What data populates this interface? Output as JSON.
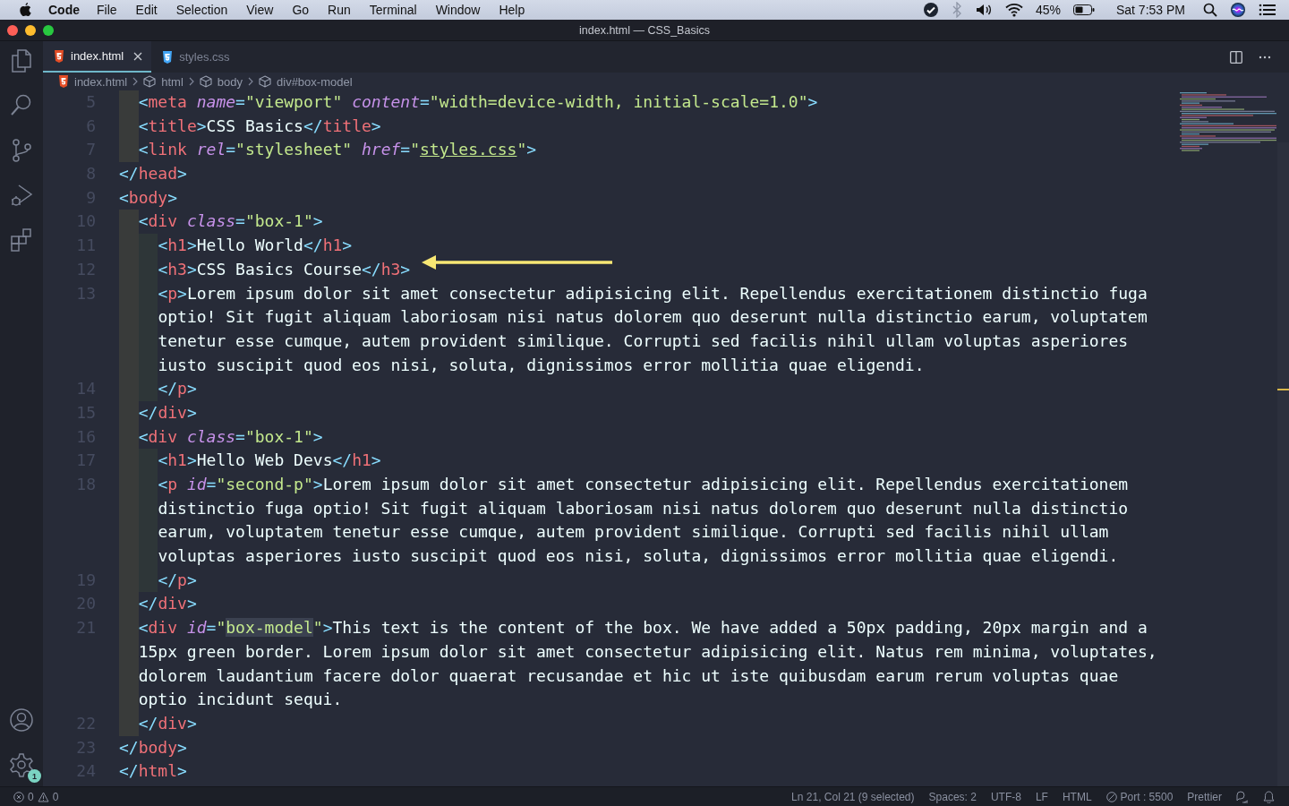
{
  "menubar": {
    "app": "Code",
    "items": [
      "File",
      "Edit",
      "Selection",
      "View",
      "Go",
      "Run",
      "Terminal",
      "Window",
      "Help"
    ],
    "battery": "45%",
    "clock": "Sat 7:53 PM"
  },
  "window": {
    "title": "index.html — CSS_Basics"
  },
  "tabs": [
    {
      "label": "index.html",
      "kind": "html",
      "selected": true
    },
    {
      "label": "styles.css",
      "kind": "css",
      "selected": false
    }
  ],
  "breadcrumbs": [
    {
      "label": "index.html",
      "kind": "file"
    },
    {
      "label": "html",
      "kind": "element"
    },
    {
      "label": "body",
      "kind": "element"
    },
    {
      "label": "div#box-model",
      "kind": "element"
    }
  ],
  "activity_bar": {
    "settings_badge": "1"
  },
  "code": [
    {
      "number": "5",
      "tokens": [
        {
          "kind": "p",
          "t": "  <"
        },
        {
          "kind": "tag",
          "t": "meta"
        },
        {
          "kind": "attr",
          "t": " name"
        },
        {
          "kind": "p",
          "t": "="
        },
        {
          "kind": "str",
          "t": "\"viewport\""
        },
        {
          "kind": "attr",
          "t": " content"
        },
        {
          "kind": "p",
          "t": "="
        },
        {
          "kind": "str",
          "t": "\"width=device-width, initial-scale=1.0\""
        },
        {
          "kind": "p",
          "t": ">"
        }
      ]
    },
    {
      "number": "6",
      "tokens": [
        {
          "kind": "p",
          "t": "  <"
        },
        {
          "kind": "tag",
          "t": "title"
        },
        {
          "kind": "p",
          "t": ">"
        },
        {
          "kind": "text",
          "t": "CSS Basics"
        },
        {
          "kind": "p",
          "t": "</"
        },
        {
          "kind": "tag",
          "t": "title"
        },
        {
          "kind": "p",
          "t": ">"
        }
      ]
    },
    {
      "number": "7",
      "tokens": [
        {
          "kind": "p",
          "t": "  <"
        },
        {
          "kind": "tag",
          "t": "link"
        },
        {
          "kind": "attr",
          "t": " rel"
        },
        {
          "kind": "p",
          "t": "="
        },
        {
          "kind": "str",
          "t": "\"stylesheet\""
        },
        {
          "kind": "attr",
          "t": " href"
        },
        {
          "kind": "p",
          "t": "="
        },
        {
          "kind": "str",
          "t": "\""
        },
        {
          "kind": "link",
          "t": "styles.css"
        },
        {
          "kind": "str",
          "t": "\""
        },
        {
          "kind": "p",
          "t": ">"
        }
      ]
    },
    {
      "number": "8",
      "tokens": [
        {
          "kind": "p",
          "t": "</"
        },
        {
          "kind": "tag",
          "t": "head"
        },
        {
          "kind": "p",
          "t": ">"
        }
      ]
    },
    {
      "number": "9",
      "tokens": [
        {
          "kind": "p",
          "t": "<"
        },
        {
          "kind": "tag",
          "t": "body"
        },
        {
          "kind": "p",
          "t": ">"
        }
      ]
    },
    {
      "number": "10",
      "tokens": [
        {
          "kind": "p",
          "t": "  <"
        },
        {
          "kind": "tag",
          "t": "div"
        },
        {
          "kind": "attr",
          "t": " class"
        },
        {
          "kind": "p",
          "t": "="
        },
        {
          "kind": "str",
          "t": "\"box-1\""
        },
        {
          "kind": "p",
          "t": ">"
        }
      ]
    },
    {
      "number": "11",
      "tokens": [
        {
          "kind": "p",
          "t": "    <"
        },
        {
          "kind": "tag",
          "t": "h1"
        },
        {
          "kind": "p",
          "t": ">"
        },
        {
          "kind": "text",
          "t": "Hello World"
        },
        {
          "kind": "p",
          "t": "</"
        },
        {
          "kind": "tag",
          "t": "h1"
        },
        {
          "kind": "p",
          "t": ">"
        }
      ]
    },
    {
      "number": "12",
      "tokens": [
        {
          "kind": "p",
          "t": "    <"
        },
        {
          "kind": "tag",
          "t": "h3"
        },
        {
          "kind": "p",
          "t": ">"
        },
        {
          "kind": "text",
          "t": "CSS Basics Course"
        },
        {
          "kind": "p",
          "t": "</"
        },
        {
          "kind": "tag",
          "t": "h3"
        },
        {
          "kind": "p",
          "t": ">"
        }
      ]
    },
    {
      "number": "13",
      "tokens": [
        {
          "kind": "p",
          "t": "    <"
        },
        {
          "kind": "tag",
          "t": "p"
        },
        {
          "kind": "p",
          "t": ">"
        },
        {
          "kind": "text",
          "t": "Lorem ipsum dolor sit amet consectetur adipisicing elit. Repellendus exercitationem distinctio fuga"
        }
      ]
    },
    {
      "tokens": [
        {
          "kind": "text",
          "t": "    optio! Sit fugit aliquam laboriosam nisi natus dolorem quo deserunt nulla distinctio earum, voluptatem"
        }
      ]
    },
    {
      "tokens": [
        {
          "kind": "text",
          "t": "    tenetur esse cumque, autem provident similique. Corrupti sed facilis nihil ullam voluptas asperiores"
        }
      ]
    },
    {
      "tokens": [
        {
          "kind": "text",
          "t": "    iusto suscipit quod eos nisi, soluta, dignissimos error mollitia quae eligendi."
        }
      ]
    },
    {
      "number": "14",
      "tokens": [
        {
          "kind": "p",
          "t": "    </"
        },
        {
          "kind": "tag",
          "t": "p"
        },
        {
          "kind": "p",
          "t": ">"
        }
      ]
    },
    {
      "number": "15",
      "tokens": [
        {
          "kind": "p",
          "t": "  </"
        },
        {
          "kind": "tag",
          "t": "div"
        },
        {
          "kind": "p",
          "t": ">"
        }
      ]
    },
    {
      "number": "16",
      "tokens": [
        {
          "kind": "p",
          "t": "  <"
        },
        {
          "kind": "tag",
          "t": "div"
        },
        {
          "kind": "attr",
          "t": " class"
        },
        {
          "kind": "p",
          "t": "="
        },
        {
          "kind": "str",
          "t": "\"box-1\""
        },
        {
          "kind": "p",
          "t": ">"
        }
      ]
    },
    {
      "number": "17",
      "tokens": [
        {
          "kind": "p",
          "t": "    <"
        },
        {
          "kind": "tag",
          "t": "h1"
        },
        {
          "kind": "p",
          "t": ">"
        },
        {
          "kind": "text",
          "t": "Hello Web Devs"
        },
        {
          "kind": "p",
          "t": "</"
        },
        {
          "kind": "tag",
          "t": "h1"
        },
        {
          "kind": "p",
          "t": ">"
        }
      ]
    },
    {
      "number": "18",
      "tokens": [
        {
          "kind": "p",
          "t": "    <"
        },
        {
          "kind": "tag",
          "t": "p"
        },
        {
          "kind": "attr",
          "t": " id"
        },
        {
          "kind": "p",
          "t": "="
        },
        {
          "kind": "str",
          "t": "\"second-p\""
        },
        {
          "kind": "p",
          "t": ">"
        },
        {
          "kind": "text",
          "t": "Lorem ipsum dolor sit amet consectetur adipisicing elit. Repellendus exercitationem"
        }
      ]
    },
    {
      "tokens": [
        {
          "kind": "text",
          "t": "    distinctio fuga optio! Sit fugit aliquam laboriosam nisi natus dolorem quo deserunt nulla distinctio"
        }
      ]
    },
    {
      "tokens": [
        {
          "kind": "text",
          "t": "    earum, voluptatem tenetur esse cumque, autem provident similique. Corrupti sed facilis nihil ullam"
        }
      ]
    },
    {
      "tokens": [
        {
          "kind": "text",
          "t": "    voluptas asperiores iusto suscipit quod eos nisi, soluta, dignissimos error mollitia quae eligendi."
        }
      ]
    },
    {
      "number": "19",
      "tokens": [
        {
          "kind": "p",
          "t": "    </"
        },
        {
          "kind": "tag",
          "t": "p"
        },
        {
          "kind": "p",
          "t": ">"
        }
      ]
    },
    {
      "number": "20",
      "tokens": [
        {
          "kind": "p",
          "t": "  </"
        },
        {
          "kind": "tag",
          "t": "div"
        },
        {
          "kind": "p",
          "t": ">"
        }
      ]
    },
    {
      "number": "21",
      "tokens": [
        {
          "kind": "p",
          "t": "  <"
        },
        {
          "kind": "tag",
          "t": "div"
        },
        {
          "kind": "attr",
          "t": " id"
        },
        {
          "kind": "p",
          "t": "="
        },
        {
          "kind": "str",
          "t": "\""
        },
        {
          "kind": "sel",
          "t": "box-model"
        },
        {
          "kind": "str",
          "t": "\""
        },
        {
          "kind": "p",
          "t": ">"
        },
        {
          "kind": "text",
          "t": "This text is the content of the box. We have added a 50px padding, 20px margin and a"
        }
      ]
    },
    {
      "tokens": [
        {
          "kind": "text",
          "t": "  15px green border. Lorem ipsum dolor sit amet consectetur adipisicing elit. Natus rem minima, voluptates,"
        }
      ]
    },
    {
      "tokens": [
        {
          "kind": "text",
          "t": "  dolorem laudantium facere dolor quaerat recusandae et hic ut iste quibusdam earum rerum voluptas quae"
        }
      ]
    },
    {
      "tokens": [
        {
          "kind": "text",
          "t": "  optio incidunt sequi."
        }
      ]
    },
    {
      "number": "22",
      "tokens": [
        {
          "kind": "p",
          "t": "  </"
        },
        {
          "kind": "tag",
          "t": "div"
        },
        {
          "kind": "p",
          "t": ">"
        }
      ]
    },
    {
      "number": "23",
      "tokens": [
        {
          "kind": "p",
          "t": "</"
        },
        {
          "kind": "tag",
          "t": "body"
        },
        {
          "kind": "p",
          "t": ">"
        }
      ]
    },
    {
      "number": "24",
      "tokens": [
        {
          "kind": "p",
          "t": "</"
        },
        {
          "kind": "tag",
          "t": "html"
        },
        {
          "kind": "p",
          "t": ">"
        }
      ]
    }
  ],
  "status_bar": {
    "errors": "0",
    "warnings": "0",
    "items": [
      {
        "label": "Ln 21, Col 21 (9 selected)",
        "kind": "text"
      },
      {
        "label": "Spaces: 2",
        "kind": "text"
      },
      {
        "label": "UTF-8",
        "kind": "text"
      },
      {
        "label": "LF",
        "kind": "text"
      },
      {
        "label": "HTML",
        "kind": "text"
      },
      {
        "label": "Port : 5500",
        "kind": "port"
      },
      {
        "label": "Prettier",
        "kind": "text"
      }
    ]
  }
}
